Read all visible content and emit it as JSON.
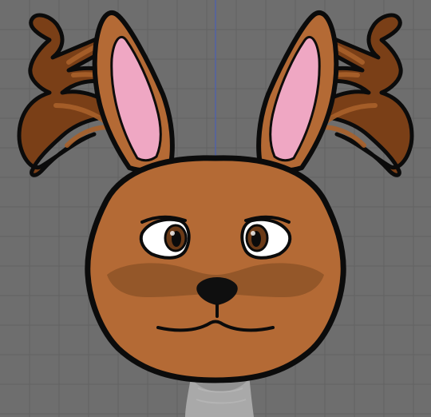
{
  "viewport": {
    "colors": {
      "background": "#6e6e6e",
      "grid_major": "#5a5a5a",
      "grid_minor": "#666666",
      "axis_line": "#4f62a8"
    }
  },
  "character": {
    "name_hint": "jackalope-head-sketch",
    "colors": {
      "fur": "#b46a35",
      "fur_shade": "#8e5327",
      "outline": "#0b0b0b",
      "ear_inner": "#f1a9c6",
      "antler": "#7a3f17",
      "antler_highlight": "#a9602a",
      "eye_white": "#ffffff",
      "eye_iris": "#6b3a17",
      "nose": "#0f0f0f",
      "stand": "#a9a9a9",
      "stand_shadow": "#8e8e8e"
    }
  }
}
